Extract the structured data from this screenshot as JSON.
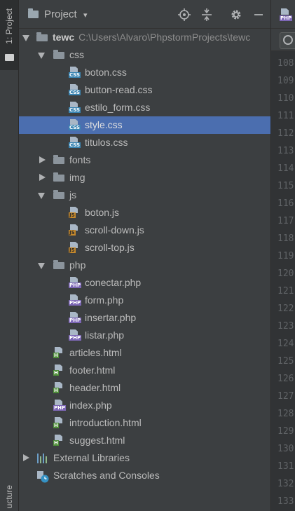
{
  "side_strip": {
    "project_tab": "1: Project",
    "structure_tab": "ucture"
  },
  "header": {
    "title": "Project",
    "dropdown_symbol": "▾",
    "icons": [
      "locate-icon",
      "collapse-all-icon",
      "gear-icon",
      "minimize-icon"
    ]
  },
  "tree": {
    "root": {
      "name": "tewc",
      "path": "C:\\Users\\Alvaro\\PhpstormProjects\\tewc"
    },
    "css_folder": "css",
    "css_files": [
      "boton.css",
      "button-read.css",
      "estilo_form.css",
      "style.css",
      "titulos.css"
    ],
    "fonts_folder": "fonts",
    "img_folder": "img",
    "js_folder": "js",
    "js_files": [
      "boton.js",
      "scroll-down.js",
      "scroll-top.js"
    ],
    "php_folder": "php",
    "php_files": [
      "conectar.php",
      "form.php",
      "insertar.php",
      "listar.php"
    ],
    "root_files": [
      {
        "name": "articles.html",
        "type": "html"
      },
      {
        "name": "footer.html",
        "type": "html"
      },
      {
        "name": "header.html",
        "type": "html"
      },
      {
        "name": "index.php",
        "type": "php"
      },
      {
        "name": "introduction.html",
        "type": "html"
      },
      {
        "name": "suggest.html",
        "type": "html"
      }
    ],
    "external_libraries": "External Libraries",
    "scratches": "Scratches and Consoles",
    "selected": "style.css"
  },
  "icon_tags": {
    "css": "CSS",
    "js": "JS",
    "php": "PHP",
    "html": "H"
  },
  "gutter": {
    "line_numbers": [
      "108",
      "109",
      "110",
      "111",
      "112",
      "113",
      "114",
      "115",
      "116",
      "117",
      "118",
      "119",
      "120",
      "121",
      "122",
      "123",
      "124",
      "125",
      "126",
      "127",
      "128",
      "129",
      "130",
      "131",
      "132",
      "133"
    ]
  },
  "colors": {
    "selection": "#4b6eaf",
    "background": "#3c3f41"
  }
}
